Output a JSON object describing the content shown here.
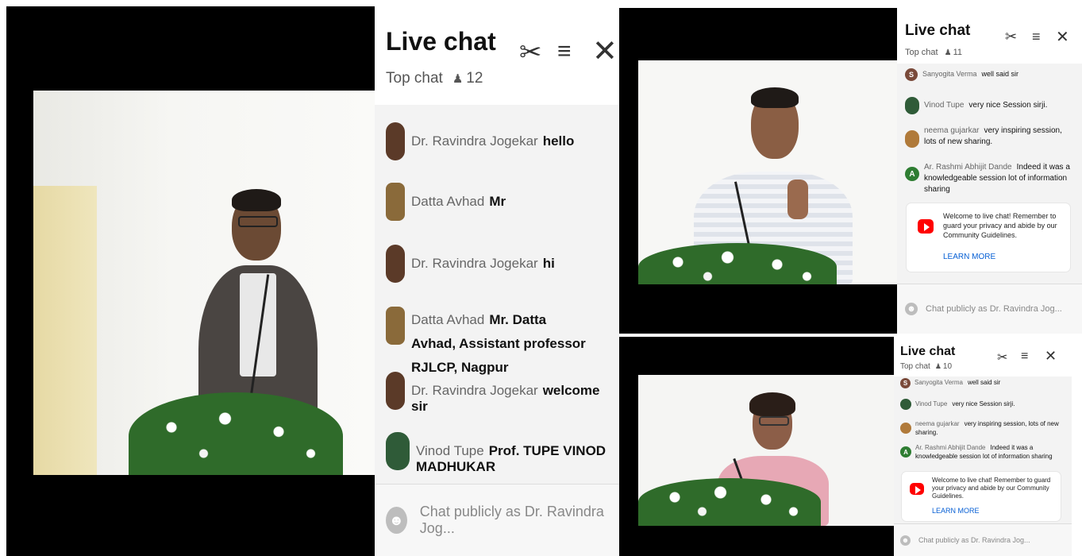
{
  "panels": {
    "main": {
      "title": "Live chat",
      "subtitle": "Top chat",
      "viewers": "12",
      "messages": [
        {
          "author": "Dr. Ravindra Jogekar",
          "text": "hello"
        },
        {
          "author": "Datta Avhad",
          "text": "Mr"
        },
        {
          "author": "Dr. Ravindra Jogekar",
          "text": "hi"
        },
        {
          "author": "Datta Avhad",
          "text": "Mr. Datta Avhad, Assistant professor RJLCP, Nagpur"
        },
        {
          "author": "Dr. Ravindra Jogekar",
          "text": "welcome sir"
        },
        {
          "author": "Vinod Tupe",
          "text": "Prof. TUPE VINOD MADHUKAR"
        }
      ],
      "input_placeholder": "Chat publicly as Dr. Ravindra Jog..."
    },
    "top_right": {
      "title": "Live chat",
      "subtitle": "Top chat",
      "viewers": "11",
      "messages": [
        {
          "initial": "S",
          "author": "Sanyogita Verma",
          "text": "well said sir"
        },
        {
          "initial": "",
          "author": "Vinod Tupe",
          "text": "very nice Session sirji."
        },
        {
          "initial": "",
          "author": "neema gujarkar",
          "text": "very inspiring session, lots of new sharing."
        },
        {
          "initial": "A",
          "author": "Ar. Rashmi Abhijit Dande",
          "text": "Indeed it was a knowledgeable session lot of information sharing"
        }
      ],
      "welcome_text": "Welcome to live chat! Remember to guard your privacy and abide by our Community Guidelines.",
      "learn_more": "LEARN MORE",
      "input_placeholder": "Chat publicly as Dr. Ravindra Jog..."
    },
    "bottom_right": {
      "title": "Live chat",
      "subtitle": "Top chat",
      "viewers": "10",
      "messages": [
        {
          "initial": "S",
          "author": "Sanyogita Verma",
          "text": "well said sir"
        },
        {
          "initial": "",
          "author": "Vinod Tupe",
          "text": "very nice Session sirji."
        },
        {
          "initial": "",
          "author": "neema gujarkar",
          "text": "very inspiring session, lots of new sharing."
        },
        {
          "initial": "A",
          "author": "Ar. Rashmi Abhijit Dande",
          "text": "Indeed it was a knowledgeable session lot of information sharing"
        }
      ],
      "welcome_text": "Welcome to live chat! Remember to guard your privacy and abide by our Community Guidelines.",
      "learn_more": "LEARN MORE",
      "input_placeholder": "Chat publicly as Dr. Ravindra Jog..."
    }
  },
  "icons": {
    "clip": "scissors-icon",
    "filter": "sliders-icon",
    "close": "close-icon",
    "viewers": "person-icon",
    "emoji": "smiley-icon"
  },
  "colors": {
    "youtube_red": "#ff0000",
    "link_blue": "#065fd4",
    "avatar_s": "#7a4a3a",
    "avatar_a": "#2e7d32"
  }
}
